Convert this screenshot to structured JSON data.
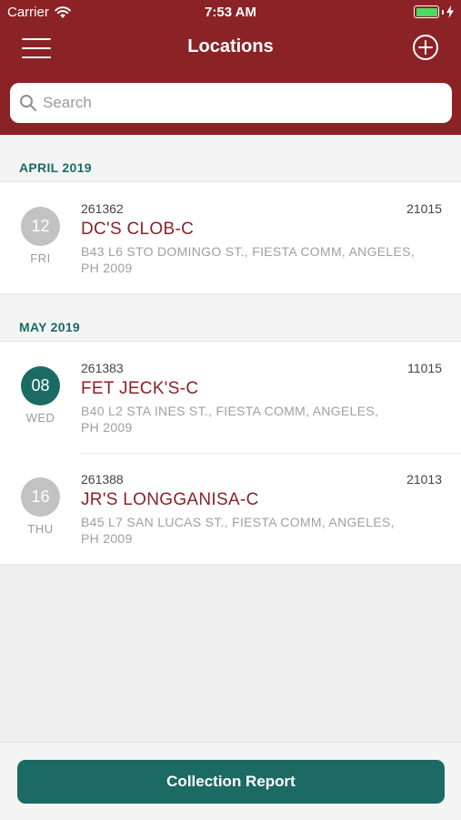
{
  "status_bar": {
    "carrier": "Carrier",
    "time": "7:53 AM"
  },
  "nav": {
    "title": "Locations",
    "menu_icon": "hamburger-menu-icon",
    "add_icon": "plus-circle-icon"
  },
  "search": {
    "placeholder": "Search",
    "value": ""
  },
  "sections": [
    {
      "header": "APRIL 2019",
      "items": [
        {
          "day": "12",
          "weekday": "FRI",
          "account": "261362",
          "code": "21015",
          "name": "DC'S CLOB-C",
          "address_line1": "B43 L6 STO DOMINGO ST., FIESTA COMM, ANGELES,",
          "address_line2": "PH 2009"
        }
      ]
    },
    {
      "header": "MAY 2019",
      "items": [
        {
          "day": "08",
          "weekday": "WED",
          "account": "261383",
          "code": "11015",
          "name": "FET JECK'S-C",
          "address_line1": "B40 L2 STA INES ST., FIESTA COMM, ANGELES,",
          "address_line2": "PH 2009"
        },
        {
          "day": "16",
          "weekday": "THU",
          "account": "261388",
          "code": "21013",
          "name": "JR'S LONGGANISA-C",
          "address_line1": "B45 L7 SAN LUCAS ST., FIESTA COMM, ANGELES,",
          "address_line2": "PH 2009"
        }
      ]
    }
  ],
  "footer": {
    "button_label": "Collection Report"
  },
  "colors": {
    "brand": "#8b2226",
    "accent": "#1b6b64",
    "past_date": "#c2c2c2"
  }
}
